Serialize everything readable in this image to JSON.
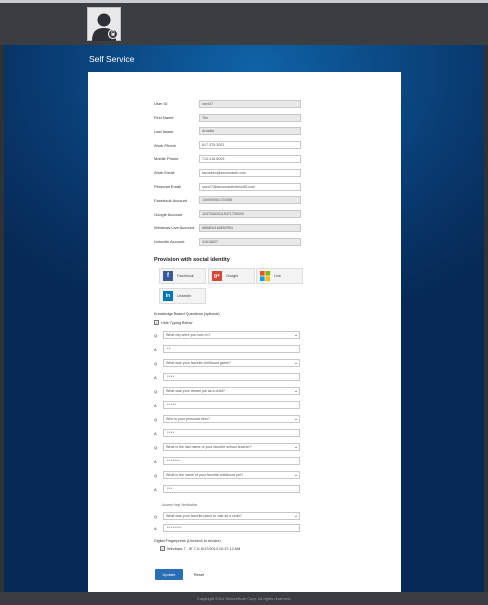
{
  "header": {
    "title": "Self Service"
  },
  "colors": {
    "accent": "#2a6fb5",
    "topbar": "#3a3d42",
    "facebook": "#3b5998",
    "google": "#d34836",
    "linkedin": "#0077b5"
  },
  "fields": [
    {
      "label": "User ID",
      "value": "user27",
      "readonly": true
    },
    {
      "label": "First Name",
      "value": "Tim",
      "readonly": true
    },
    {
      "label": "Last Name",
      "value": "Arcadia",
      "readonly": true
    },
    {
      "label": "Work Phone",
      "value": "617-375-3002",
      "readonly": false
    },
    {
      "label": "Mobile Phone",
      "value": "714-418-6003",
      "readonly": false
    },
    {
      "label": "Work Email",
      "value": "farcadien@secureauth.com",
      "readonly": false
    },
    {
      "label": "Personal Email",
      "value": "user27@secureauthdemo55.com",
      "readonly": false
    },
    {
      "label": "Facebook Account",
      "value": "100009061724386",
      "readonly": true
    },
    {
      "label": "Google Account",
      "value": "103754634115371758309",
      "readonly": true
    },
    {
      "label": "Windows Live Account",
      "value": "6f6683c1b5692994",
      "readonly": true
    },
    {
      "label": "LinkedIn Account",
      "value": "41618527",
      "readonly": true
    }
  ],
  "social": {
    "title": "Provision with social identity",
    "buttons": [
      {
        "label": "Facebook",
        "icon": "facebook-icon",
        "glyph": "f"
      },
      {
        "label": "Google",
        "icon": "google-plus-icon",
        "glyph": "g+"
      },
      {
        "label": "Live",
        "icon": "windows-live-icon",
        "glyph": ""
      },
      {
        "label": "LinkedIn",
        "icon": "linkedin-icon",
        "glyph": "in"
      }
    ]
  },
  "kba": {
    "title": "Knowledge Based Questions (optional)",
    "hide_label": "Hide Typing Below",
    "q_prefix": "Q",
    "a_prefix": "A",
    "items": [
      {
        "question": "What city were you born in?",
        "answer": "**"
      },
      {
        "question": "What was your favorite childhood game?",
        "answer": "****"
      },
      {
        "question": "What was your dream job as a child?",
        "answer": "*****"
      },
      {
        "question": "Who is your personal hero?",
        "answer": "****"
      },
      {
        "question": "What is the last name of your favorite school teacher?",
        "answer": "*******"
      },
      {
        "question": "What is the name of your favorite childhood pet?",
        "answer": "***"
      }
    ]
  },
  "special": {
    "label": "Access Help Verification",
    "question": "What was your favorite place to visit as a child?",
    "answer": "********"
  },
  "fingerprints": {
    "title": "Digital Fingerprints (Uncheck to revoke)",
    "item": "Windows 7 - IE 7.0: 6/17/2014 10:27:12 AM"
  },
  "actions": {
    "update": "Update",
    "reset": "Reset"
  },
  "footer": {
    "text": "Copyright 2014 SecureAuth Corp. All rights reserved."
  }
}
